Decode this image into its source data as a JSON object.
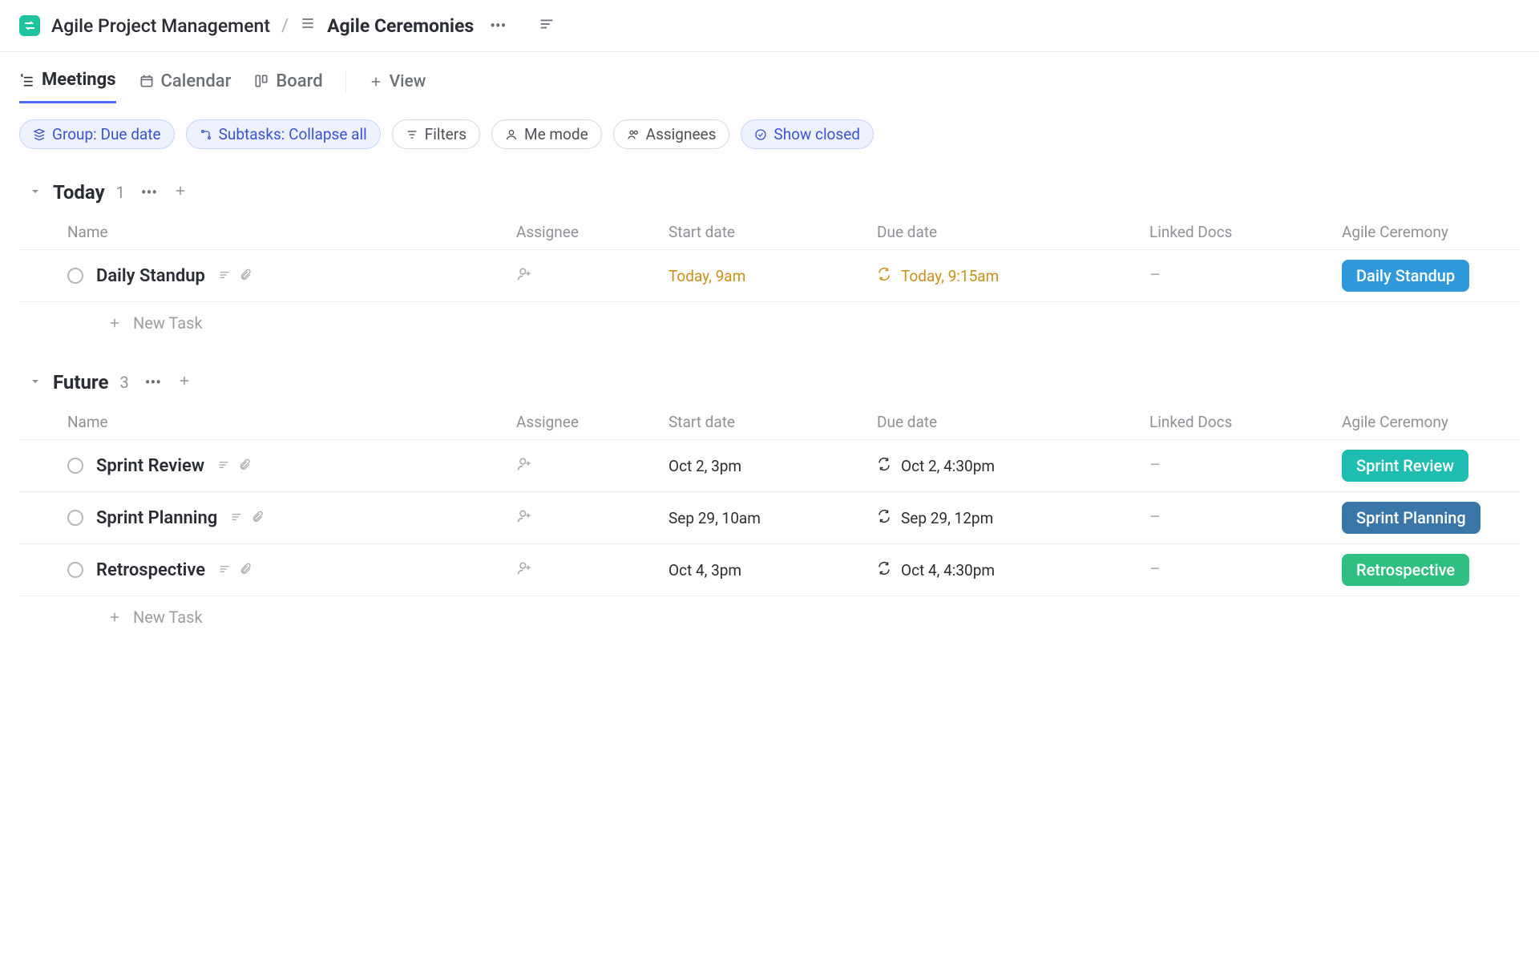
{
  "header": {
    "space": "Agile Project Management",
    "current": "Agile Ceremonies"
  },
  "tabs": {
    "meetings": "Meetings",
    "calendar": "Calendar",
    "board": "Board",
    "view": "View"
  },
  "chips": {
    "group": "Group: Due date",
    "subtasks": "Subtasks: Collapse all",
    "filters": "Filters",
    "me": "Me mode",
    "assignees": "Assignees",
    "closed": "Show closed"
  },
  "columns": {
    "name": "Name",
    "assignee": "Assignee",
    "start": "Start date",
    "due": "Due date",
    "linked": "Linked Docs",
    "ceremony": "Agile Ceremony"
  },
  "placeholders": {
    "new_task": "New Task",
    "linked_empty": "–"
  },
  "groups": [
    {
      "name": "Today",
      "count": "1",
      "rows": [
        {
          "name": "Daily Standup",
          "start": "Today, 9am",
          "due": "Today, 9:15am",
          "highlight": true,
          "ceremony": {
            "label": "Daily Standup",
            "color": "#3099db"
          }
        }
      ]
    },
    {
      "name": "Future",
      "count": "3",
      "rows": [
        {
          "name": "Sprint Review",
          "start": "Oct 2, 3pm",
          "due": "Oct 2, 4:30pm",
          "highlight": false,
          "ceremony": {
            "label": "Sprint Review",
            "color": "#1fbdb1"
          }
        },
        {
          "name": "Sprint Planning",
          "start": "Sep 29, 10am",
          "due": "Sep 29, 12pm",
          "highlight": false,
          "ceremony": {
            "label": "Sprint Planning",
            "color": "#3a77a8"
          }
        },
        {
          "name": "Retrospective",
          "start": "Oct 4, 3pm",
          "due": "Oct 4, 4:30pm",
          "highlight": false,
          "ceremony": {
            "label": "Retrospective",
            "color": "#30bf83"
          }
        }
      ]
    }
  ]
}
